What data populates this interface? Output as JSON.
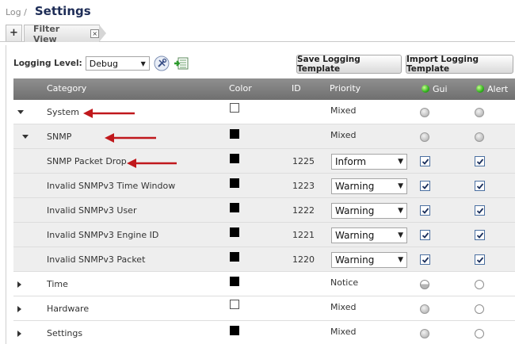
{
  "breadcrumb": {
    "parent": "Log /",
    "title": "Settings"
  },
  "tabs": {
    "add_label": "+",
    "filter_view": "Filter View",
    "close": "×"
  },
  "toolbar": {
    "logging_level_label": "Logging Level:",
    "logging_level_value": "Debug",
    "save_button": "Save Logging Template",
    "import_button": "Import Logging Template"
  },
  "columns": {
    "category": "Category",
    "color": "Color",
    "id": "ID",
    "priority": "Priority",
    "gui": "Gui",
    "alert": "Alert"
  },
  "rows": [
    {
      "category": "System",
      "expand": "down",
      "indent": 0,
      "color": "empty",
      "id": "",
      "priority": "Mixed",
      "priority_mode": "text",
      "gui": "radio-grey",
      "alert": "radio-grey",
      "shaded": false
    },
    {
      "category": "SNMP",
      "expand": "down",
      "indent": 1,
      "color": "black",
      "id": "",
      "priority": "Mixed",
      "priority_mode": "text",
      "gui": "radio-grey",
      "alert": "radio-grey",
      "shaded": true
    },
    {
      "category": "SNMP Packet Drop",
      "expand": "none",
      "indent": 2,
      "color": "black",
      "id": "1225",
      "priority": "Inform",
      "priority_mode": "select",
      "gui": "checked",
      "alert": "checked",
      "shaded": true
    },
    {
      "category": "Invalid SNMPv3 Time Window",
      "expand": "none",
      "indent": 2,
      "color": "black",
      "id": "1223",
      "priority": "Warning",
      "priority_mode": "select",
      "gui": "checked",
      "alert": "checked",
      "shaded": true
    },
    {
      "category": "Invalid SNMPv3 User",
      "expand": "none",
      "indent": 2,
      "color": "black",
      "id": "1222",
      "priority": "Warning",
      "priority_mode": "select",
      "gui": "checked",
      "alert": "checked",
      "shaded": true
    },
    {
      "category": "Invalid SNMPv3 Engine ID",
      "expand": "none",
      "indent": 2,
      "color": "black",
      "id": "1221",
      "priority": "Warning",
      "priority_mode": "select",
      "gui": "checked",
      "alert": "checked",
      "shaded": true
    },
    {
      "category": "Invalid SNMPv3 Packet",
      "expand": "none",
      "indent": 2,
      "color": "black",
      "id": "1220",
      "priority": "Warning",
      "priority_mode": "select",
      "gui": "checked",
      "alert": "checked",
      "shaded": true
    },
    {
      "category": "Time",
      "expand": "right",
      "indent": 0,
      "color": "black",
      "id": "",
      "priority": "Notice",
      "priority_mode": "text",
      "gui": "radio-half",
      "alert": "radio-empty",
      "shaded": false
    },
    {
      "category": "Hardware",
      "expand": "right",
      "indent": 0,
      "color": "empty",
      "id": "",
      "priority": "Mixed",
      "priority_mode": "text",
      "gui": "radio-grey",
      "alert": "radio-empty",
      "shaded": false
    },
    {
      "category": "Settings",
      "expand": "right",
      "indent": 0,
      "color": "black",
      "id": "",
      "priority": "Mixed",
      "priority_mode": "text",
      "gui": "radio-grey",
      "alert": "radio-empty",
      "shaded": false
    }
  ],
  "annotation_color": "#c0181c",
  "header_color": "#7f7f7f"
}
